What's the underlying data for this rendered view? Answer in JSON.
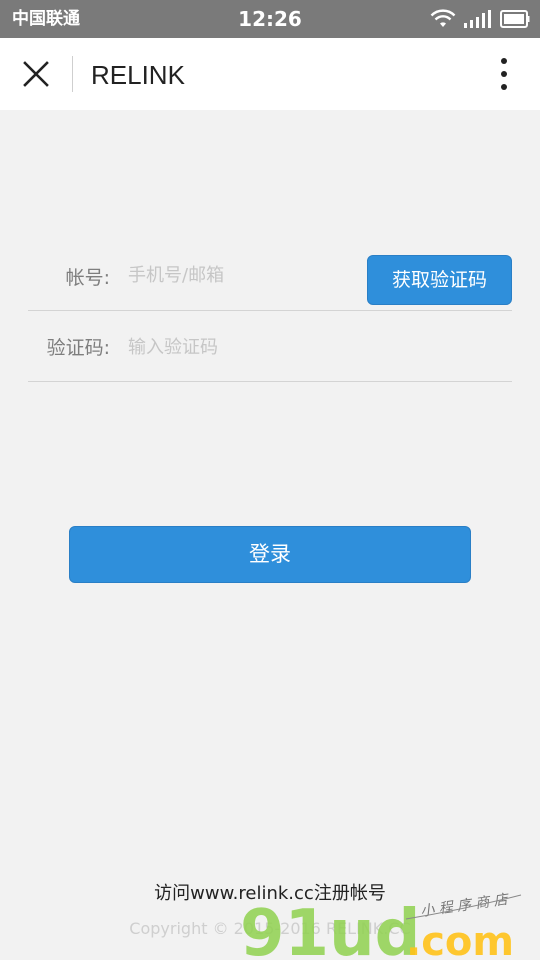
{
  "status_bar": {
    "carrier": "中国联通",
    "time": "12:26"
  },
  "nav": {
    "title": "RELINK"
  },
  "form": {
    "account_label": "帐号:",
    "account_placeholder": "手机号/邮箱",
    "account_value": "",
    "get_code_label": "获取验证码",
    "code_label": "验证码:",
    "code_placeholder": "输入验证码",
    "code_value": ""
  },
  "login_label": "登录",
  "footer": {
    "register_text": "访问www.relink.cc注册帐号",
    "copyright": "Copyright © 2015-2016 RELINK.CC"
  },
  "watermark": {
    "brand": "91ud.com",
    "tagline": "小程序商店"
  },
  "colors": {
    "primary": "#2f8fdb",
    "status_bar": "#7a7a7a",
    "background": "#f2f2f2"
  }
}
